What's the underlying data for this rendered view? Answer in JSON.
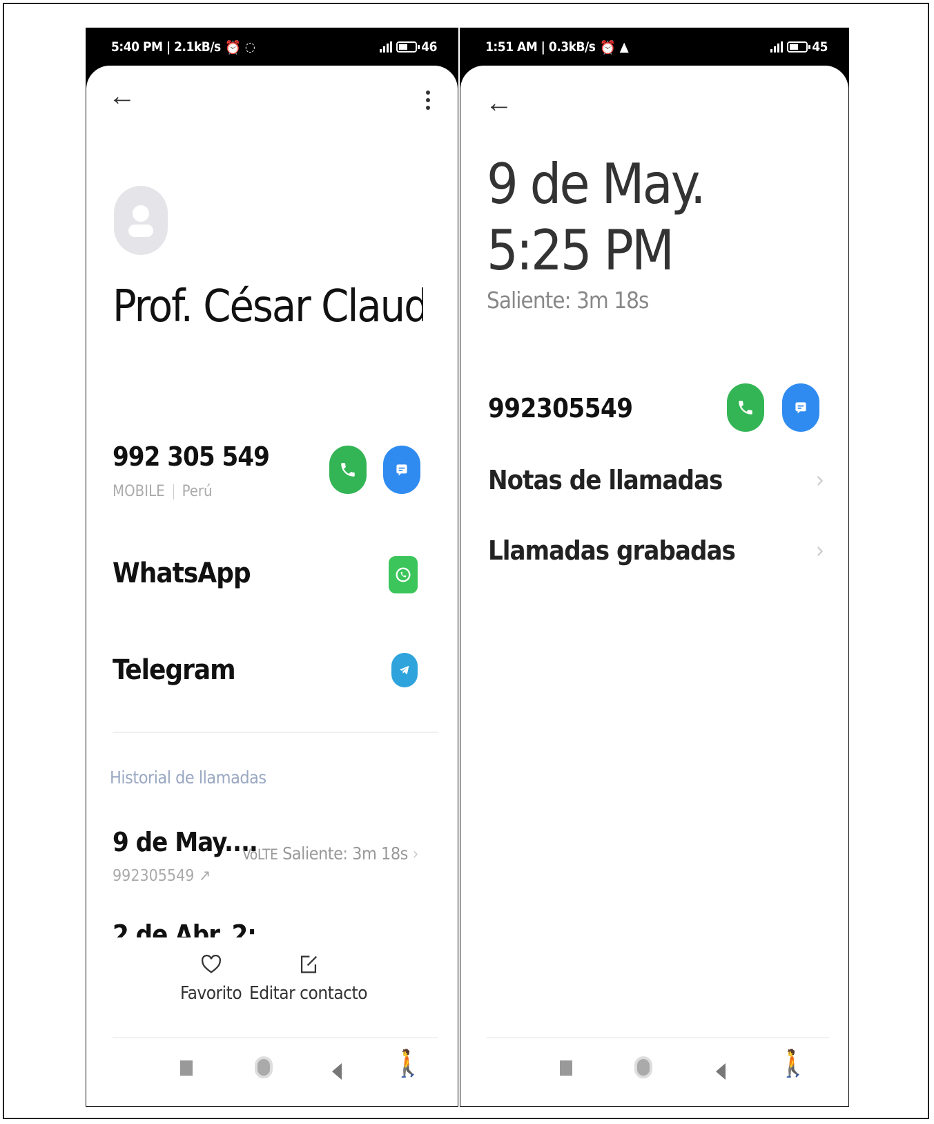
{
  "left": {
    "status": {
      "time": "5:40 PM | 2.1kB/s",
      "battery": "46"
    },
    "back_icon": "←",
    "contact_name": "Prof. César Claud",
    "phone": {
      "number": "992 305 549",
      "type": "MOBILE",
      "region": "Perú"
    },
    "apps": [
      {
        "label": "WhatsApp"
      },
      {
        "label": "Telegram"
      }
    ],
    "history": {
      "section_label": "Historial de llamadas",
      "entries": [
        {
          "date": "9 de May....",
          "number": "992305549",
          "network": "VoLTE",
          "detail": "Saliente: 3m 18s"
        },
        {
          "date": "2 de Abr. 2:"
        }
      ]
    },
    "actions": {
      "favorite": "Favorito",
      "edit": "Editar contacto"
    }
  },
  "right": {
    "status": {
      "time": "1:51 AM | 0.3kB/s",
      "battery": "45"
    },
    "back_icon": "←",
    "call_time": "9 de May. 5:25 PM",
    "call_sub": "Saliente: 3m 18s",
    "phone_number": "992305549",
    "menu": [
      {
        "label": "Notas de llamadas"
      },
      {
        "label": "Llamadas grabadas"
      }
    ]
  },
  "colors": {
    "call_green": "#33b555",
    "message_blue": "#2f8bf0",
    "whatsapp_green": "#3bc55b",
    "telegram_blue": "#2ea3dc"
  }
}
